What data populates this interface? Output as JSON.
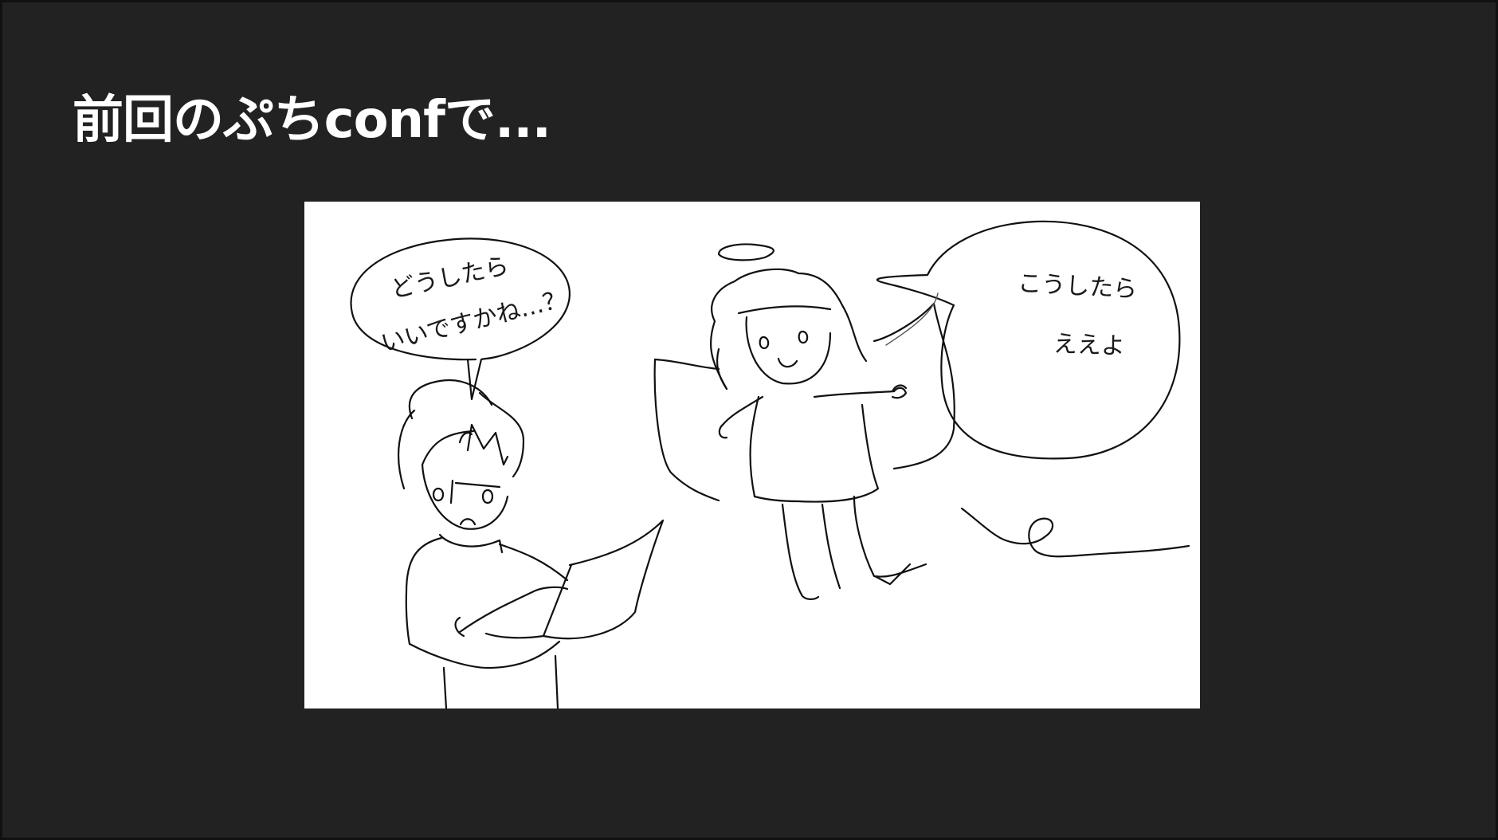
{
  "slide": {
    "title": "前回のぷちconfで...",
    "background_color": "#222222",
    "title_color": "#ffffff"
  },
  "illustration": {
    "style": "hand-drawn black line sketch on white",
    "background_color": "#ffffff",
    "left_bubble": {
      "line1": "どうしたら",
      "line2": "いいですかね…？"
    },
    "right_bubble": {
      "line1": "こうしたら",
      "line2": "ええよ"
    }
  }
}
